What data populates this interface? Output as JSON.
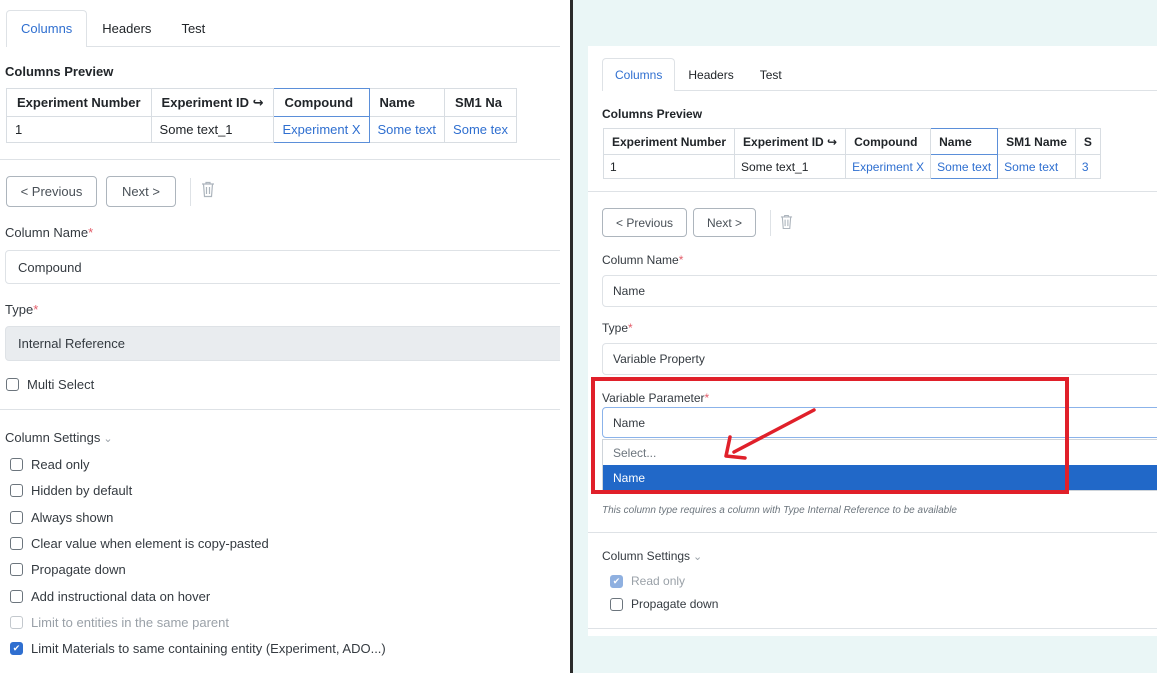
{
  "left": {
    "tabs": [
      "Columns",
      "Headers",
      "Test"
    ],
    "preview_title": "Columns Preview",
    "table": {
      "headers": [
        "Experiment Number",
        "Experiment ID ↪",
        "Compound",
        "Name",
        "SM1 Na"
      ],
      "row": [
        "1",
        "Some text_1",
        "Experiment X",
        "Some text",
        "Some tex"
      ]
    },
    "prev_label": "< Previous",
    "next_label": "Next >",
    "column_name_label": "Column Name",
    "column_name_value": "Compound",
    "type_label": "Type",
    "type_value": "Internal Reference",
    "multi_select_label": "Multi Select",
    "column_settings_label": "Column Settings",
    "settings": [
      {
        "label": "Read only",
        "checked": false,
        "muted": false
      },
      {
        "label": "Hidden by default",
        "checked": false,
        "muted": false
      },
      {
        "label": "Always shown",
        "checked": false,
        "muted": false
      },
      {
        "label": "Clear value when element is copy-pasted",
        "checked": false,
        "muted": false
      },
      {
        "label": "Propagate down",
        "checked": false,
        "muted": false
      },
      {
        "label": "Add instructional data on hover",
        "checked": false,
        "muted": false
      },
      {
        "label": "Limit to entities in the same parent",
        "checked": false,
        "muted": true
      },
      {
        "label": "Limit Materials to same containing entity (Experiment, ADO...)",
        "checked": true,
        "muted": false
      }
    ]
  },
  "right": {
    "tabs": [
      "Columns",
      "Headers",
      "Test"
    ],
    "preview_title": "Columns Preview",
    "table": {
      "headers": [
        "Experiment Number",
        "Experiment ID ↪",
        "Compound",
        "Name",
        "SM1 Name",
        "S"
      ],
      "row": [
        "1",
        "Some text_1",
        "Experiment X",
        "Some text",
        "Some text",
        "3"
      ]
    },
    "prev_label": "< Previous",
    "next_label": "Next >",
    "column_name_label": "Column Name",
    "column_name_value": "Name",
    "type_label": "Type",
    "type_value": "Variable Property",
    "variable_param_label": "Variable Parameter",
    "variable_param_value": "Name",
    "dropdown_options": [
      "Select...",
      "Name"
    ],
    "help_text": "This column type requires a column with Type Internal Reference to be available",
    "column_settings_label": "Column Settings",
    "settings": [
      {
        "label": "Read only",
        "checked": true,
        "muted": true
      },
      {
        "label": "Propagate down",
        "checked": false,
        "muted": false
      }
    ]
  },
  "colors": {
    "accent": "#2f6fd0",
    "highlight": "#e0202a",
    "right_background": "#eaf6f6",
    "selected_option": "#2168c8"
  },
  "icons": {
    "delete": "trash-icon",
    "dropdown_chevron": "chevron-down-icon",
    "annotation": "red-arrow-icon"
  },
  "required_mark": "*"
}
